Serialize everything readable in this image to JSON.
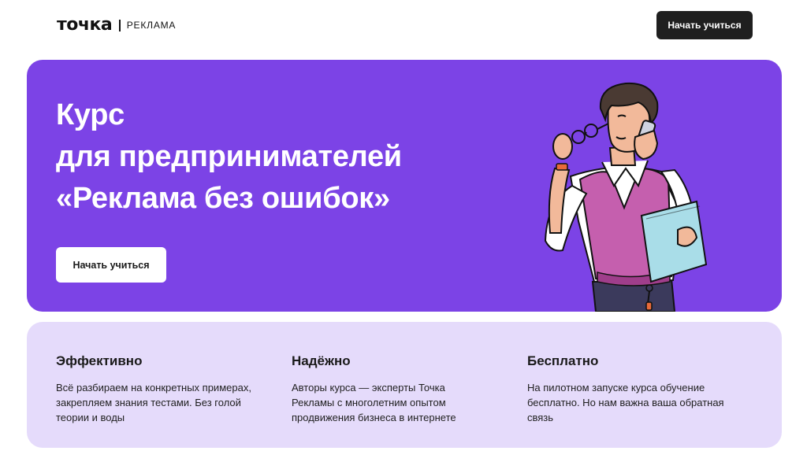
{
  "header": {
    "logo_main": "точка",
    "logo_sub": "РЕКЛАМА",
    "cta_label": "Начать учиться"
  },
  "hero": {
    "title_lines": [
      "Курс",
      "для предпринимателей",
      "«Реклама без ошибок»"
    ],
    "cta_label": "Начать учиться",
    "colors": {
      "background": "#7c43e6",
      "text": "#ffffff"
    }
  },
  "features": {
    "background": "#e5dbfb",
    "items": [
      {
        "title": "Эффективно",
        "text": "Всё разбираем на конкретных примерах, закрепляем знания тестами. Без голой теории и воды"
      },
      {
        "title": "Надёжно",
        "text": "Авторы курса — эксперты Точка Рекламы с многолетним опытом продвижения бизнеса в интернете"
      },
      {
        "title": "Бесплатно",
        "text": "На пилотном запуске курса обучение бесплатно. Но нам важна ваша обратная связь"
      }
    ]
  }
}
